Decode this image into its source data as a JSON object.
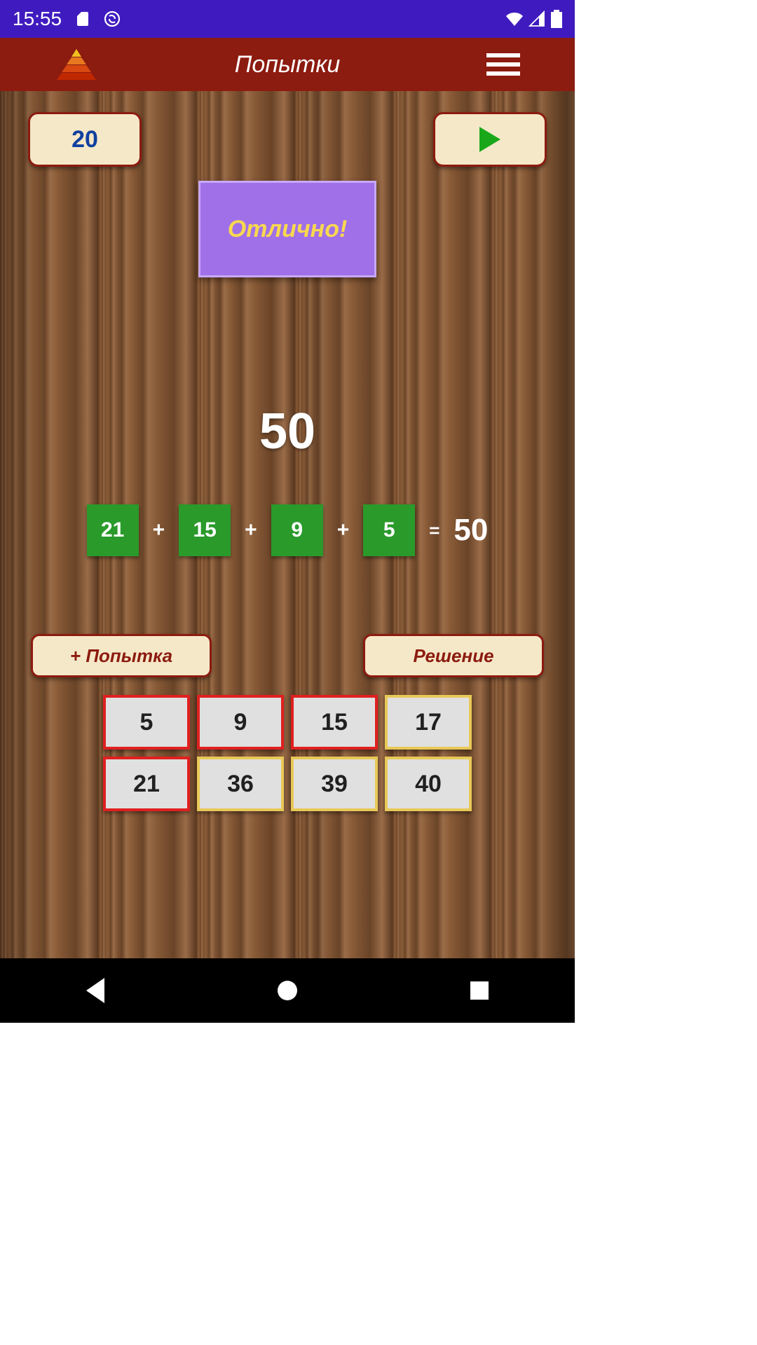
{
  "status": {
    "time": "15:55"
  },
  "appbar": {
    "title": "Попытки"
  },
  "game": {
    "score": "20",
    "message": "Отлично!",
    "target": "50",
    "equation": {
      "tiles": [
        "21",
        "15",
        "9",
        "5"
      ],
      "ops": [
        "+",
        "+",
        "+"
      ],
      "eqsign": "=",
      "sum": "50"
    },
    "actions": {
      "attempt": "+ Попытка",
      "solution": "Решение"
    },
    "grid": [
      {
        "v": "5",
        "sel": true
      },
      {
        "v": "9",
        "sel": true
      },
      {
        "v": "15",
        "sel": true
      },
      {
        "v": "17",
        "sel": false
      },
      {
        "v": "21",
        "sel": true
      },
      {
        "v": "36",
        "sel": false
      },
      {
        "v": "39",
        "sel": false
      },
      {
        "v": "40",
        "sel": false
      }
    ]
  }
}
